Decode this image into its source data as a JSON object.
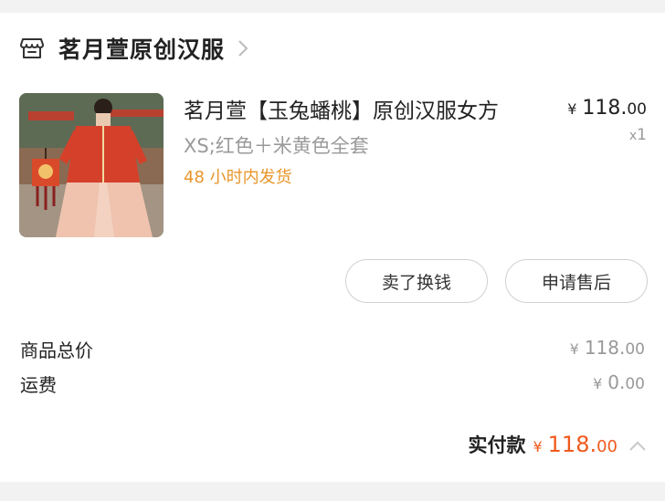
{
  "shop": {
    "name": "茗月萱原创汉服",
    "icon": "store-icon",
    "arrow_icon": "chevron-right-icon"
  },
  "product": {
    "title": "茗月萱【玉兔蟠桃】原创汉服女方",
    "sku": "XS;红色＋米黄色全套",
    "shipping": "48 小时内发货",
    "price": {
      "currency": "¥",
      "int": "118.",
      "dec": "00"
    },
    "qty_prefix": "x",
    "qty": "1"
  },
  "actions": {
    "sell": "卖了换钱",
    "after_sale": "申请售后"
  },
  "summary": {
    "goods_total": {
      "label": "商品总价",
      "currency": "¥",
      "int": "118.",
      "dec": "00"
    },
    "shipping_fee": {
      "label": "运费",
      "currency": "¥",
      "int": "0.",
      "dec": "00"
    },
    "paid": {
      "label": "实付款",
      "currency": "¥",
      "int": "118.",
      "dec": "00"
    }
  },
  "colors": {
    "accent": "#ef5a1d",
    "shipping_text": "#e8962b",
    "muted": "#999999"
  }
}
